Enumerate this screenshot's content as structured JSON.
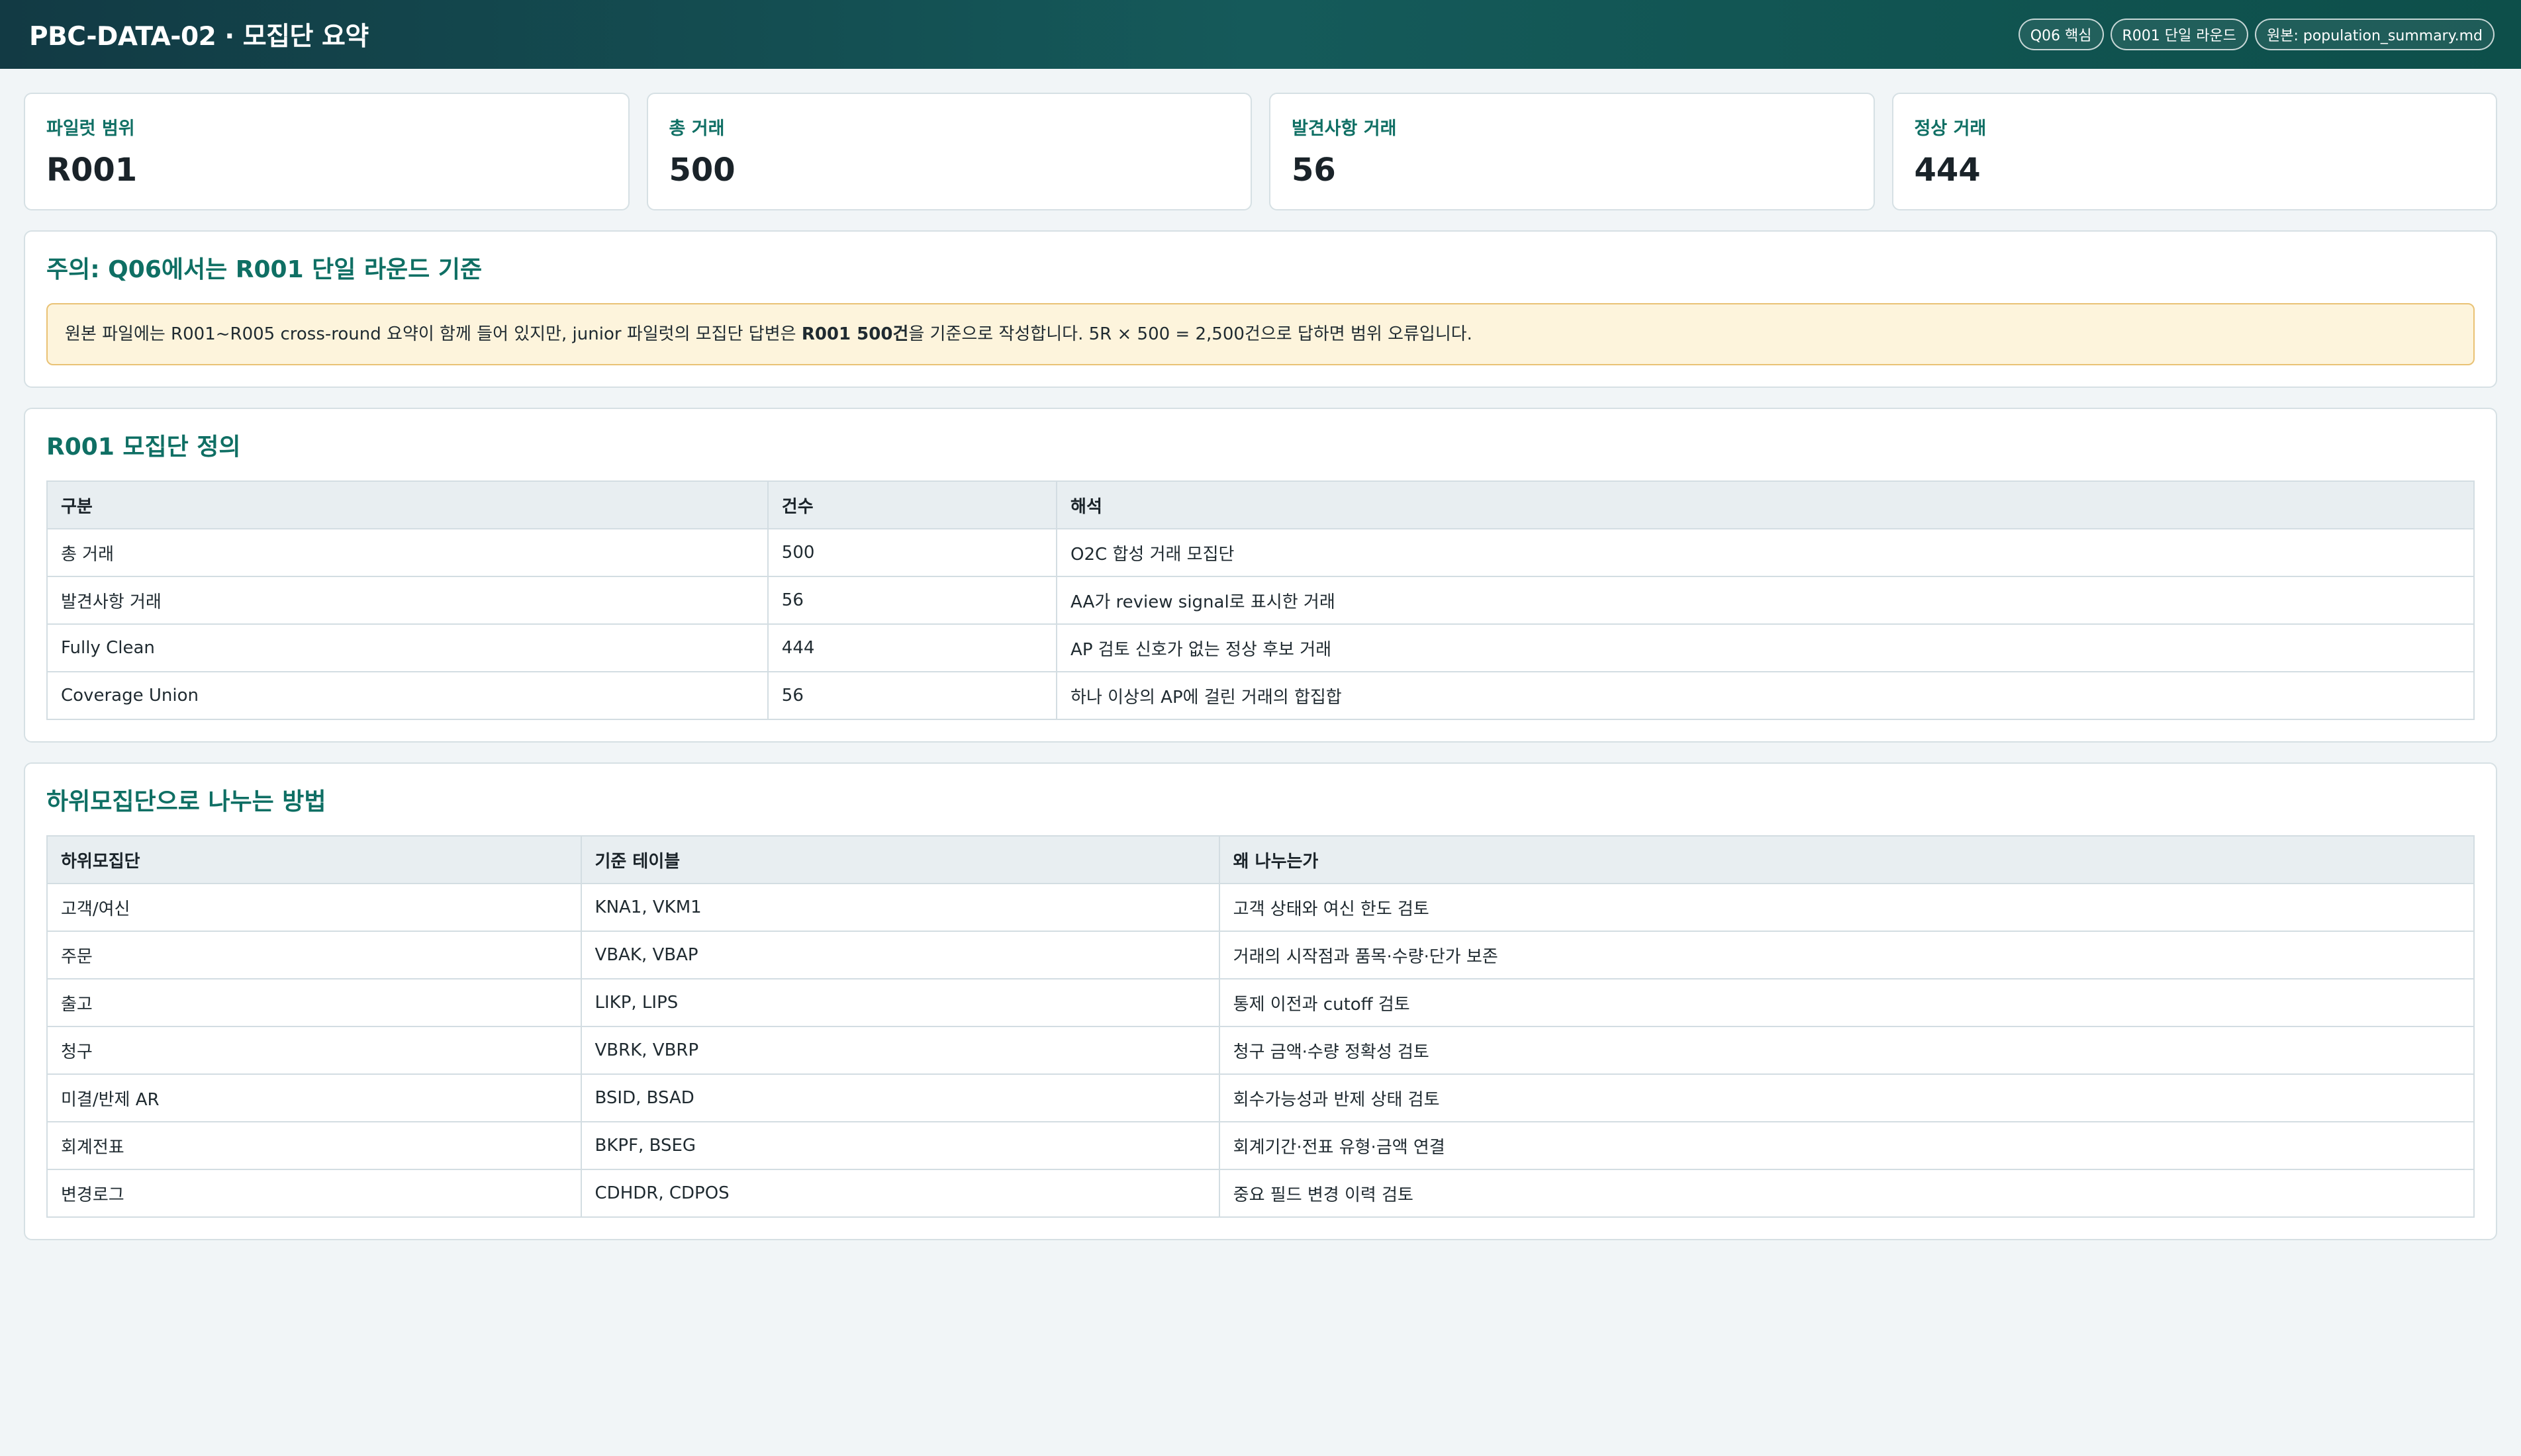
{
  "header": {
    "title": "PBC-DATA-02 · 모집단 요약",
    "badges": [
      "Q06 핵심",
      "R001 단일 라운드",
      "원본: population_summary.md"
    ]
  },
  "stats": [
    {
      "label": "파일럿 범위",
      "value": "R001"
    },
    {
      "label": "총 거래",
      "value": "500"
    },
    {
      "label": "발견사항 거래",
      "value": "56"
    },
    {
      "label": "정상 거래",
      "value": "444"
    }
  ],
  "notice": {
    "title": "주의: Q06에서는 R001 단일 라운드 기준",
    "text_before": "원본 파일에는 R001~R005 cross-round 요약이 함께 들어 있지만, junior 파일럿의 모집단 답변은 ",
    "text_bold": "R001 500건",
    "text_after": "을 기준으로 작성합니다. 5R × 500 = 2,500건으로 답하면 범위 오류입니다."
  },
  "definition": {
    "title": "R001 모집단 정의",
    "headers": [
      "구분",
      "건수",
      "해석"
    ],
    "rows": [
      [
        "총 거래",
        "500",
        "O2C 합성 거래 모집단"
      ],
      [
        "발견사항 거래",
        "56",
        "AA가 review signal로 표시한 거래"
      ],
      [
        "Fully Clean",
        "444",
        "AP 검토 신호가 없는 정상 후보 거래"
      ],
      [
        "Coverage Union",
        "56",
        "하나 이상의 AP에 걸린 거래의 합집합"
      ]
    ]
  },
  "subpop": {
    "title": "하위모집단으로 나누는 방법",
    "headers": [
      "하위모집단",
      "기준 테이블",
      "왜 나누는가"
    ],
    "rows": [
      [
        "고객/여신",
        "KNA1, VKM1",
        "고객 상태와 여신 한도 검토"
      ],
      [
        "주문",
        "VBAK, VBAP",
        "거래의 시작점과 품목·수량·단가 보존"
      ],
      [
        "출고",
        "LIKP, LIPS",
        "통제 이전과 cutoff 검토"
      ],
      [
        "청구",
        "VBRK, VBRP",
        "청구 금액·수량 정확성 검토"
      ],
      [
        "미결/반제 AR",
        "BSID, BSAD",
        "회수가능성과 반제 상태 검토"
      ],
      [
        "회계전표",
        "BKPF, BSEG",
        "회계기간·전표 유형·금액 연결"
      ],
      [
        "변경로그",
        "CDHDR, CDPOS",
        "중요 필드 변경 이력 검토"
      ]
    ]
  }
}
